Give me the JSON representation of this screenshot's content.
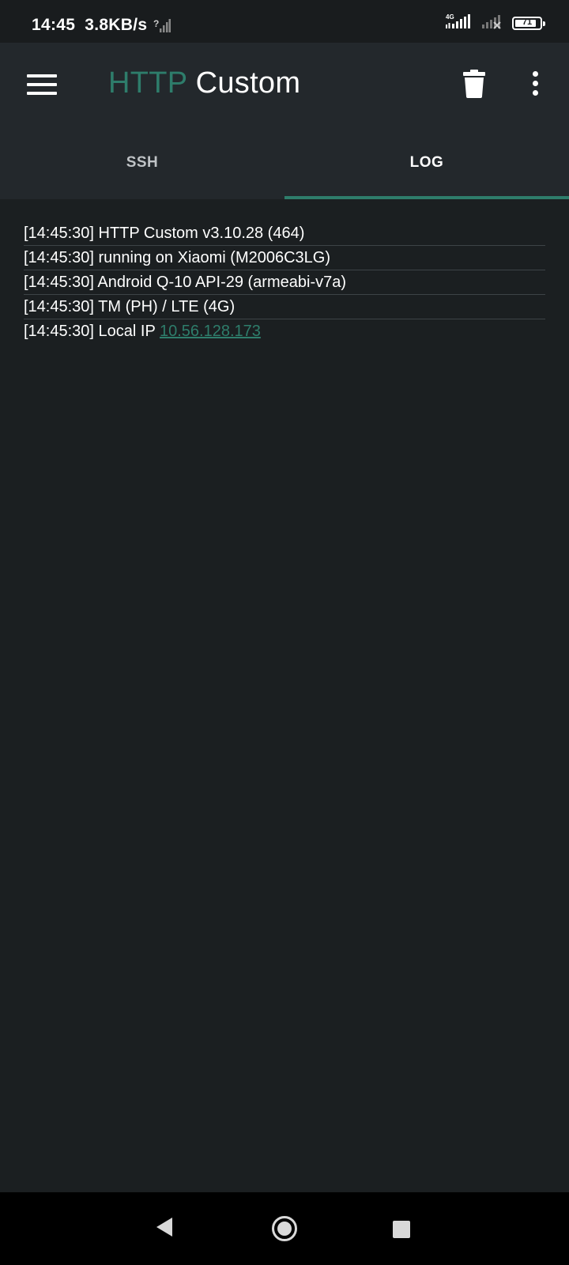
{
  "status_bar": {
    "time": "14:45",
    "speed": "3.8KB/s",
    "network_type": "4G",
    "battery_level": "71",
    "icons": [
      "wifi-question-icon",
      "signal-4g-icon",
      "signal-no-service-icon",
      "battery-icon"
    ]
  },
  "toolbar": {
    "title_accent": "HTTP",
    "title_main": "Custom",
    "icons": [
      "menu-icon",
      "delete-icon",
      "more-options-icon"
    ],
    "accent_color": "#2e7d6b"
  },
  "tabs": [
    {
      "label": "SSH",
      "active": false
    },
    {
      "label": "LOG",
      "active": true
    }
  ],
  "log": {
    "lines": [
      "[14:45:30] HTTP Custom v3.10.28 (464)",
      "[14:45:30] running on Xiaomi (M2006C3LG)",
      "[14:45:30] Android Q-10 API-29 (armeabi-v7a)",
      "[14:45:30] TM (PH) / LTE (4G)"
    ],
    "last_line_prefix": "[14:45:30] Local IP ",
    "last_line_ip": "10.56.128.173"
  },
  "nav_bar": {
    "icons": [
      "back-icon",
      "home-icon",
      "recents-icon"
    ]
  }
}
